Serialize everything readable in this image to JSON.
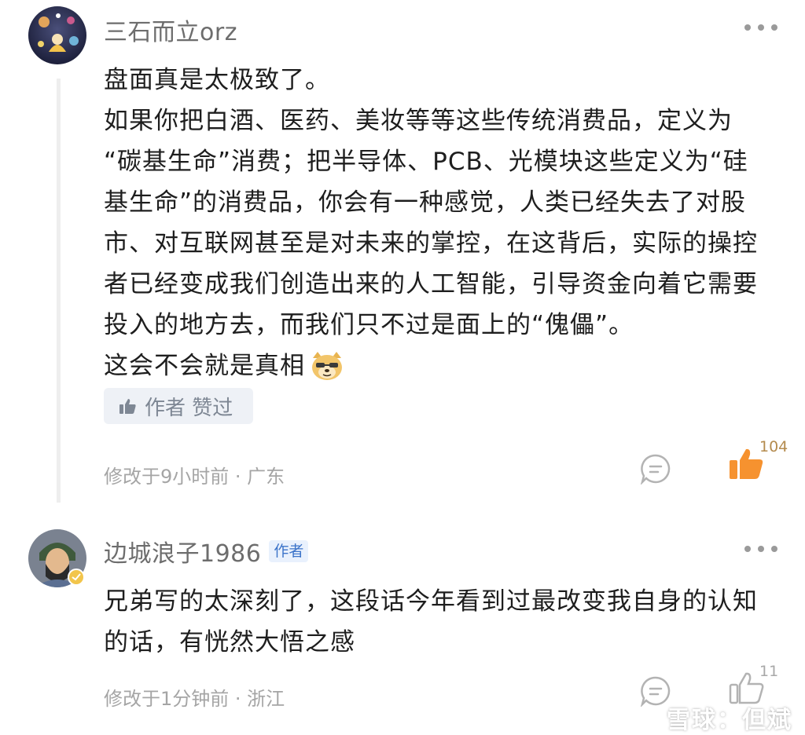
{
  "comments": [
    {
      "username": "三石而立orz",
      "paragraphs": [
        "盘面真是太极致了。",
        "如果你把白酒、医药、美妆等等这些传统消费品，定义为",
        "“碳基生命”消费；把半导体、PCB、光模块这些定义为“硅",
        "基生命”的消费品，你会有一种感觉，人类已经失去了对股",
        "市、对互联网甚至是对未来的掌控，在这背后，实际的操控",
        "者已经变成我们创造出来的人工智能，引导资金向着它需要",
        "投入的地方去，而我们只不过是面上的“傀儡”。",
        "这会不会就是真相"
      ],
      "author_liked_label": "作者 赞过",
      "meta": "修改于9小时前 · 广东",
      "like_count": "104",
      "liked": true
    },
    {
      "username": "边城浪子1986",
      "author_tag": "作者",
      "paragraphs": [
        "兄弟写的太深刻了，这段话今年看到过最改变我自身的认知",
        "的话，有恍然大悟之感"
      ],
      "meta": "修改于1分钟前 · 浙江",
      "like_count": "11",
      "liked": false
    }
  ],
  "watermark": "雪球：但斌",
  "colors": {
    "liked_orange": "#f6922f",
    "meta_grey": "#a5a5a5",
    "author_tag_blue": "#3b73c9"
  },
  "icons": [
    "more-dots-icon",
    "thumbs-up-icon",
    "reply-bubble-icon",
    "doge-emoji-icon",
    "snowball-logo-icon"
  ]
}
